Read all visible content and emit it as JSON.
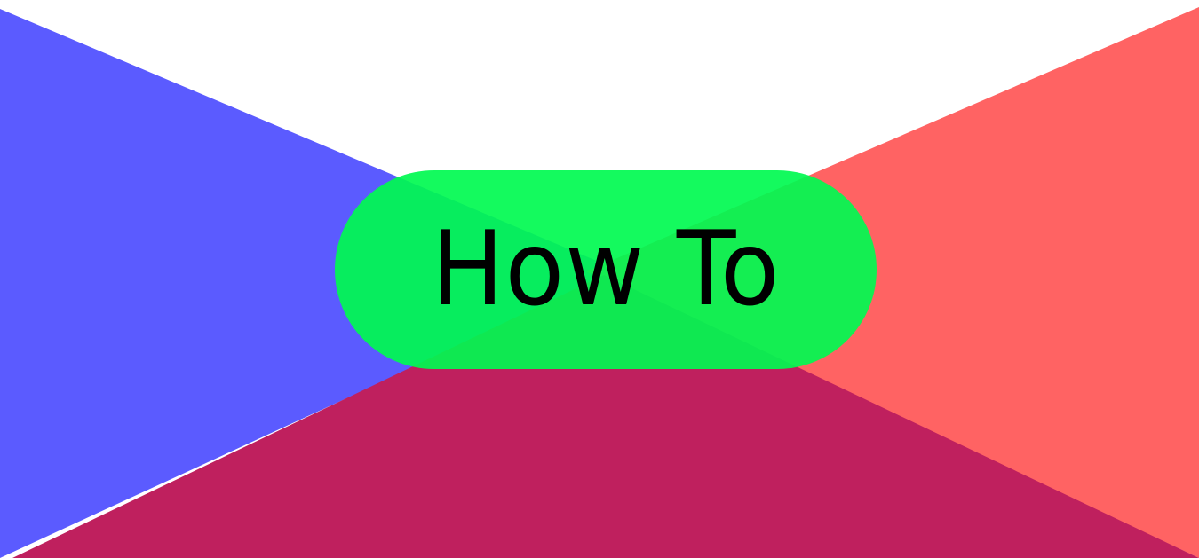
{
  "banner": {
    "label": "How To"
  },
  "colors": {
    "background": "#ffffff",
    "left_triangle": "#5b5bff",
    "right_triangle": "#ff6363",
    "bottom_triangle": "#bf205e",
    "pill": "#10f55a",
    "text": "#000000"
  }
}
